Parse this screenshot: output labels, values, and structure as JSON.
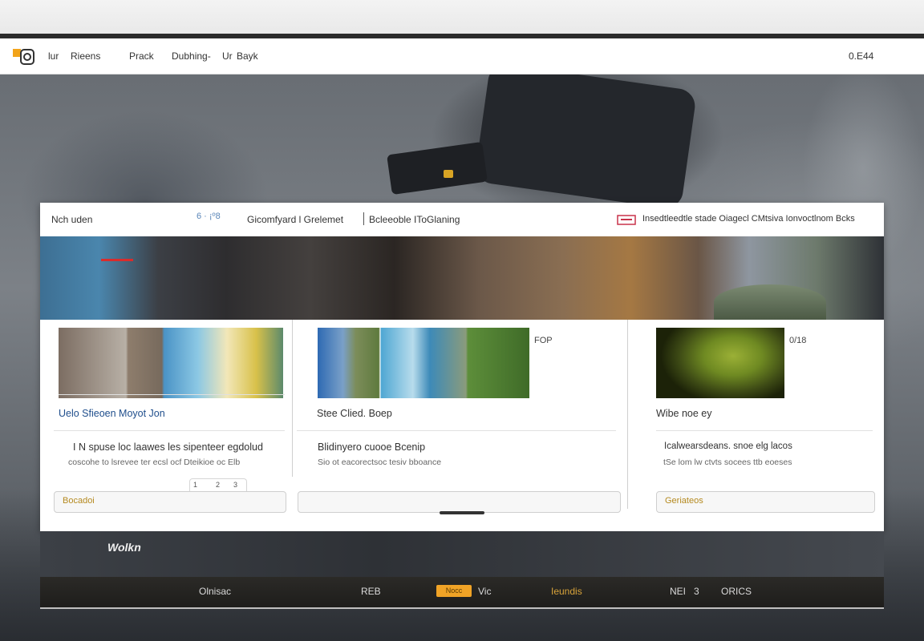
{
  "navbar": {
    "items": [
      "lur",
      "Rieens",
      "Prack",
      "Dubhing-",
      "Ur",
      "Bayk"
    ],
    "right": "0.E44"
  },
  "card": {
    "head_left": "Nch uden",
    "head_icon_text": "6 · ¡º8",
    "head_center": "Gicomfyard l Grelemet",
    "head_center2": "Bcleeoble IToGlaning",
    "head_right": "Insedtleedtle stade Oiagecl CMtsiva Ionvoctlnom Bcks"
  },
  "columns": [
    {
      "title": "Uelo Sfieoen Moyot  Jon",
      "subtitle": "I N spuse  loc laawes les sipenteer egdolud",
      "desc": "coscohe to lsrevee ter ecsl ocf Dteikioe oc Elb",
      "stepper": [
        "1",
        "2",
        "3"
      ],
      "button": "Bocadoi"
    },
    {
      "title": "Stee Clied. Boep",
      "subtitle": "Blidinyero cuooe Bcenip",
      "desc": "Sio ot eacorectsoc tesiv bboance",
      "badge": "FOP",
      "button": ""
    },
    {
      "title": "Wibe noe ey",
      "subtitle": "Icalwearsdeans. snoe elg lacos",
      "desc": "tSe lom lw ctvts socees ttb eoeses",
      "badge": "0/18",
      "button": "Geriateos"
    }
  ],
  "bottom_logo": "Wolkn",
  "footer": {
    "items": [
      "Olnisac",
      "REB",
      "Vic",
      "Ieundis",
      "NEI",
      "3",
      "ORICS"
    ],
    "badge": "Nocc"
  }
}
